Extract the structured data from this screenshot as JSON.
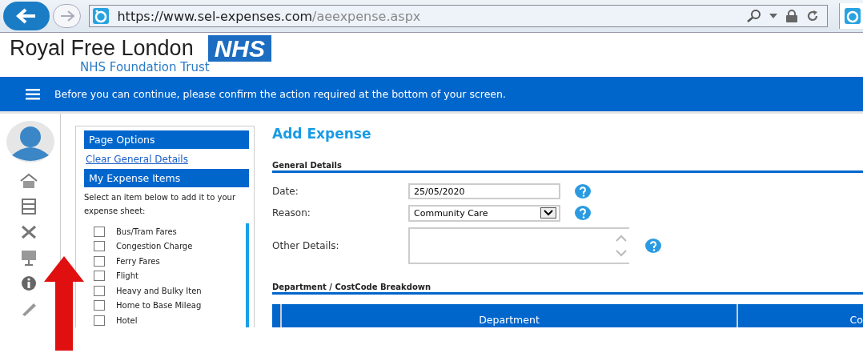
{
  "browser": {
    "url_host": "https://www.sel-expenses.com",
    "url_path": "/aeexpense.aspx"
  },
  "header": {
    "title": "Royal Free London",
    "badge": "NHS",
    "subtitle": "NHS Foundation Trust"
  },
  "banner": {
    "message": "Before you can continue, please confirm the action required at the bottom of your screen."
  },
  "page_options": {
    "title": "Page Options",
    "link": "Clear General Details",
    "items_title": "My Expense Items",
    "instructions": "Select an item below to add it to your expense sheet:",
    "items": [
      {
        "label": "Bus/Tram Fares",
        "checked": false
      },
      {
        "label": "Congestion Charge",
        "checked": false
      },
      {
        "label": "Ferry Fares",
        "checked": false
      },
      {
        "label": "Flight",
        "checked": false
      },
      {
        "label": "Heavy and Bulky Iten",
        "checked": false
      },
      {
        "label": "Home to Base Mileag",
        "checked": false
      },
      {
        "label": "Hotel",
        "checked": false
      }
    ]
  },
  "form": {
    "title": "Add Expense",
    "section": "General Details",
    "fields": [
      {
        "kind": "text",
        "label": "Date:",
        "value": "25/05/2020"
      },
      {
        "kind": "select",
        "label": "Reason:",
        "value": "Community Care"
      },
      {
        "kind": "textarea",
        "label": "Other Details:"
      }
    ],
    "breakdown": {
      "title": "Department / CostCode Breakdown",
      "columns": [
        "Department",
        "Co"
      ]
    }
  }
}
